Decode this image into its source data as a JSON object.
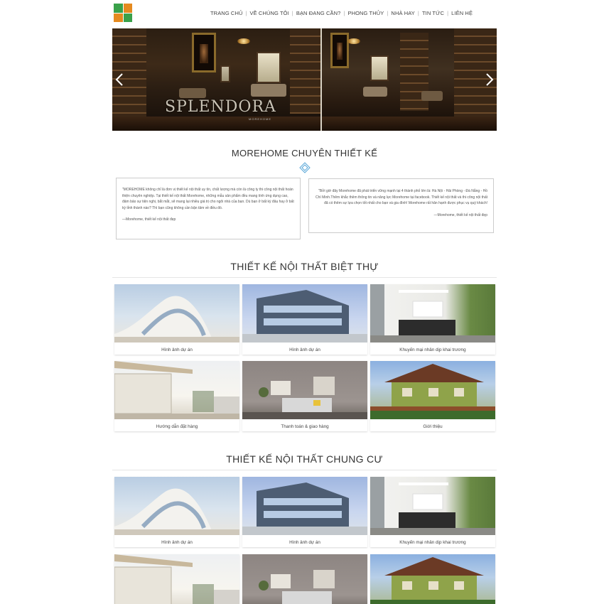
{
  "header": {
    "logo_colors": [
      "#3aa14a",
      "#e58a1f",
      "#e58a1f",
      "#3aa14a"
    ],
    "nav": [
      {
        "label": "TRANG CHỦ"
      },
      {
        "label": "VỀ CHÚNG TÔI"
      },
      {
        "label": "BẠN ĐANG CẦN?"
      },
      {
        "label": "PHONG THỦY"
      },
      {
        "label": "NHÀ HAY"
      },
      {
        "label": "TIN TỨC"
      },
      {
        "label": "LIÊN HỆ"
      }
    ]
  },
  "slider": {
    "brand_text": "SPLENDORA",
    "brand_sub": "MOREHOME"
  },
  "intro": {
    "title": "MOREHOME CHUYÊN THIẾT KẾ",
    "quotes": [
      {
        "text": "\"MOREHOME không chỉ là đơn vị thiết kế nội thất uy tín, chất lượng mà còn là công ty thi công nội thất hoàn thiện chuyên nghiệp. Tại thiết kế nội thất Morehome, những mẫu sản phẩm đều mang tính ứng dụng cao, đảm bảo sự tiện nghi, bắt mắt, sẽ mang lại nhiều giá trị cho ngôi nhà của bạn. Dù bạn ở bất kỳ đâu hay ở bất kỳ tỉnh thành nào? Thì bạn cũng không cần bận tâm về điều đó.",
        "author": "—Morehome, thiết kế nội thất đẹp"
      },
      {
        "text": "\"Bởi giờ đây Morehome đã phát triển vững mạnh tại 4 thành phố lớn là: Hà Nội - Hải Phòng - Đà Nẵng - Hồ Chí Minh.Thêm khắc thêm thông tin và năng lực Morehome tại facebook. Thiết kế nội thất và thi công nội thất đã có thêm sự lựa chọn tốt nhất cho bạn và gia đình! Morehome rất hân hạnh được phục vụ quý khách!",
        "author": "—Morehome, thiết kế nội thất đẹp"
      }
    ]
  },
  "villa": {
    "title": "THIẾT KẾ NỘI THẤT BIỆT THỰ",
    "cards": [
      {
        "caption": "Hình ảnh dự án",
        "icon": "curve-building-image"
      },
      {
        "caption": "Hình ảnh dự án",
        "icon": "modern-tower-image"
      },
      {
        "caption": "Khuyến mại nhân dịp khai trương",
        "icon": "bathroom-image"
      },
      {
        "caption": "Hướng dẫn đặt hàng",
        "icon": "terrace-image"
      },
      {
        "caption": "Thanh toán & giao hàng",
        "icon": "living-room-image"
      },
      {
        "caption": "Giới thiệu",
        "icon": "house-image"
      }
    ]
  },
  "apartment": {
    "title": "THIẾT KẾ NỘI THẤT CHUNG CƯ",
    "cards": [
      {
        "caption": "Hình ảnh dự án",
        "icon": "curve-building-image"
      },
      {
        "caption": "Hình ảnh dự án",
        "icon": "modern-tower-image"
      },
      {
        "caption": "Khuyến mại nhân dịp khai trương",
        "icon": "bathroom-image"
      },
      {
        "caption": "",
        "icon": "terrace-image"
      },
      {
        "caption": "",
        "icon": "living-room-image"
      },
      {
        "caption": "",
        "icon": "house-image"
      }
    ]
  }
}
